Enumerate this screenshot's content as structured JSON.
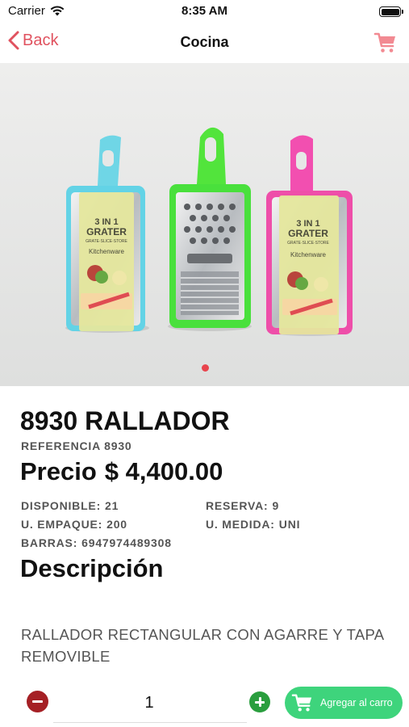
{
  "status_bar": {
    "carrier": "Carrier",
    "time": "8:35 AM",
    "wifi_icon": "wifi-icon",
    "battery_icon": "battery-icon"
  },
  "nav": {
    "back_label": "Back",
    "title": "Cocina",
    "back_icon": "chevron-left-icon",
    "cart_icon": "cart-icon",
    "accent_color": "#e0525f"
  },
  "gallery": {
    "image_description_icon": "product-photo",
    "page_count": 1,
    "current_page": 1,
    "dot_color": "#e8444d",
    "background_color": "#e6e7e6"
  },
  "product": {
    "title": "8930 RALLADOR",
    "reference": "REFERENCIA 8930",
    "price_label": "Precio",
    "price_value": "$ 4,400.00",
    "specs": {
      "disponible_label": "DISPONIBLE:",
      "disponible_value": "21",
      "reserva_label": "RESERVA:",
      "reserva_value": "9",
      "empaque_label": "U. EMPAQUE:",
      "empaque_value": "200",
      "medida_label": "U. MEDIDA:",
      "medida_value": "UNI",
      "barras_label": "BARRAS:",
      "barras_value": "6947974489308"
    },
    "description_title": "Descripción",
    "description_text": "RALLADOR RECTANGULAR CON AGARRE Y TAPA REMOVIBLE"
  },
  "packaging_text": {
    "line1": "3 IN 1",
    "line2": "GRATER",
    "line3": "GRATE·SLICE·STORE",
    "line4": "Kitchenware"
  },
  "cart_controls": {
    "quantity": "1",
    "minus_color": "#a52025",
    "plus_color": "#2a9e3e",
    "add_button_label": "Agregar al carro",
    "add_button_color": "#3ed47c"
  }
}
